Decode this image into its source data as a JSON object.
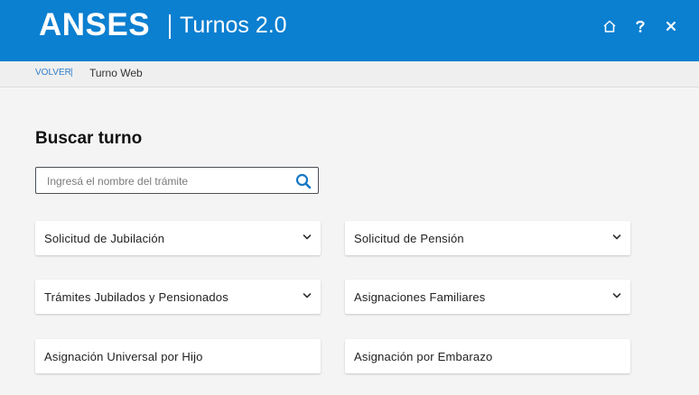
{
  "header": {
    "logo": "ANSES",
    "title": "Turnos 2.0",
    "icons": [
      "home-icon",
      "help-icon",
      "close-icon"
    ],
    "bg_color": "#0b7fd0"
  },
  "subnav": {
    "back_label": "VOLVER",
    "separator": "|",
    "breadcrumb": "Turno Web"
  },
  "main": {
    "title": "Buscar turno",
    "search": {
      "placeholder": "Ingresá el nombre del trámite",
      "value": ""
    },
    "cards": [
      {
        "label": "Solicitud de Jubilación",
        "expandable": true
      },
      {
        "label": "Solicitud de Pensión",
        "expandable": true
      },
      {
        "label": "Trámites Jubilados y Pensionados",
        "expandable": true
      },
      {
        "label": "Asignaciones Familiares",
        "expandable": true
      },
      {
        "label": "Asignación Universal por Hijo",
        "expandable": false
      },
      {
        "label": "Asignación por Embarazo",
        "expandable": false
      }
    ]
  }
}
